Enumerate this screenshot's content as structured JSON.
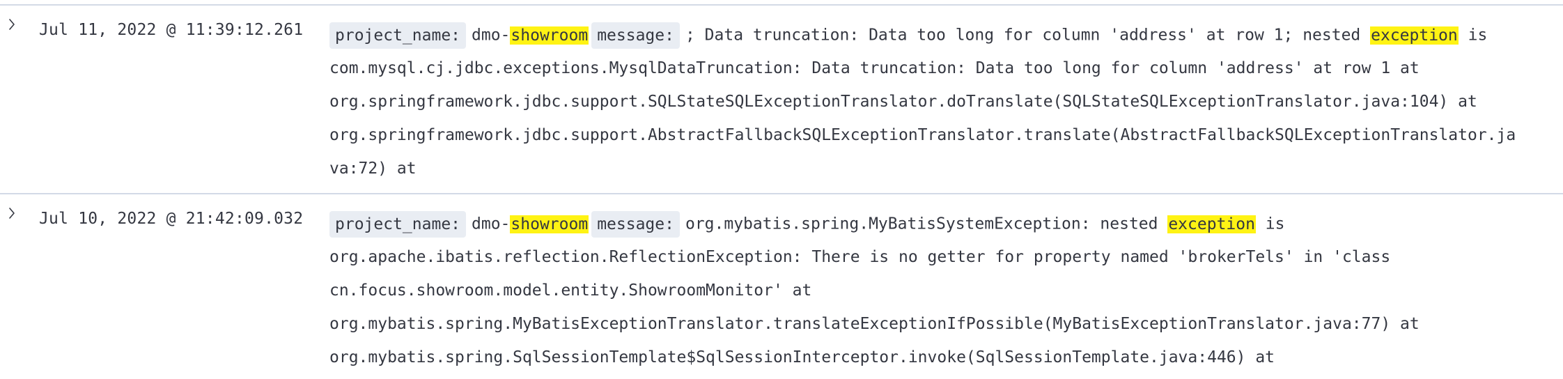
{
  "colors": {
    "highlight": "#fff314",
    "field_key_bg": "#e9edf3",
    "border": "#d3dae6",
    "text": "#343741"
  },
  "rows": [
    {
      "timestamp": "Jul 11, 2022 @ 11:39:12.261",
      "expand_icon": "chevron-right-icon",
      "project_key": "project_name:",
      "project_prefix": "dmo-",
      "project_highlight": "showroom",
      "message_key": "message:",
      "message_line1_a": "; Data truncation: Data too long for column 'address' at row 1; nested ",
      "message_line1_hl": "exception",
      "message_line1_b": " is",
      "lines": [
        "com.mysql.cj.jdbc.exceptions.MysqlDataTruncation: Data truncation: Data too long for column 'address' at row 1 at",
        "org.springframework.jdbc.support.SQLStateSQLExceptionTranslator.doTranslate(SQLStateSQLExceptionTranslator.java:104) at",
        "org.springframework.jdbc.support.AbstractFallbackSQLExceptionTranslator.translate(AbstractFallbackSQLExceptionTranslator.ja",
        "va:72) at"
      ]
    },
    {
      "timestamp": "Jul 10, 2022 @ 21:42:09.032",
      "expand_icon": "chevron-right-icon",
      "project_key": "project_name:",
      "project_prefix": "dmo-",
      "project_highlight": "showroom",
      "message_key": "message:",
      "message_line1_a": "org.mybatis.spring.MyBatisSystemException: nested ",
      "message_line1_hl": "exception",
      "message_line1_b": " is",
      "lines": [
        "org.apache.ibatis.reflection.ReflectionException: There is no getter for property named 'brokerTels' in 'class",
        "cn.focus.showroom.model.entity.ShowroomMonitor' at",
        "org.mybatis.spring.MyBatisExceptionTranslator.translateExceptionIfPossible(MyBatisExceptionTranslator.java:77) at",
        "org.mybatis.spring.SqlSessionTemplate$SqlSessionInterceptor.invoke(SqlSessionTemplate.java:446) at"
      ]
    }
  ]
}
